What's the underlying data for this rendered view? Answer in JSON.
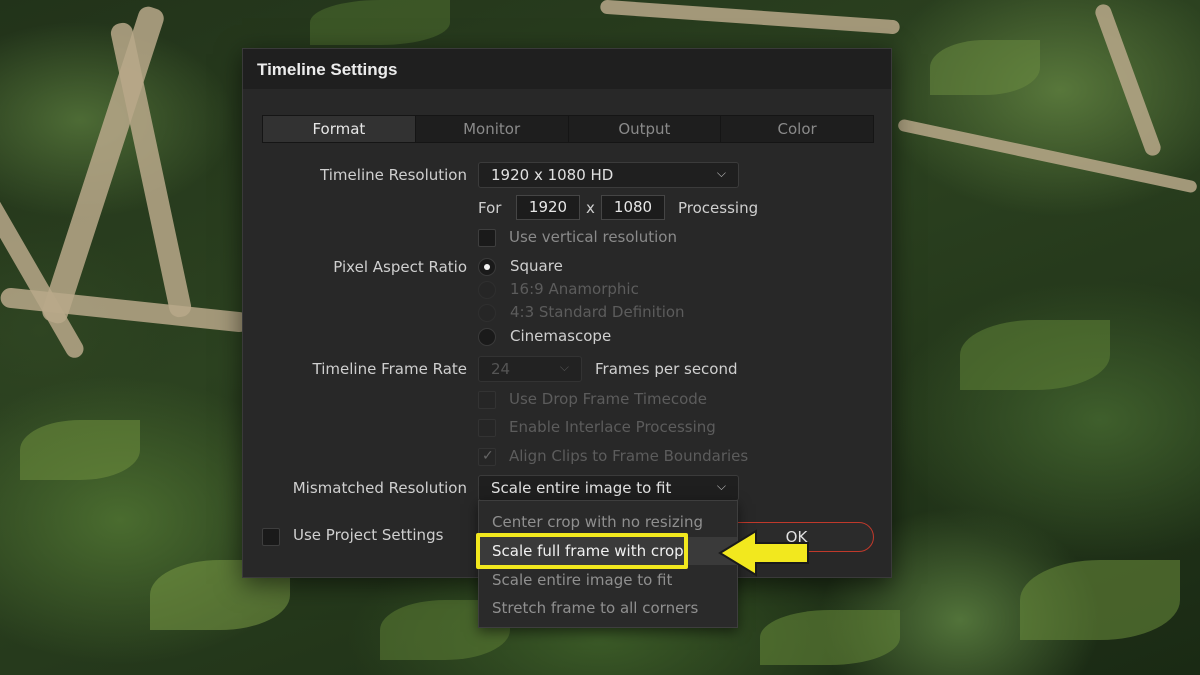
{
  "dialog": {
    "title": "Timeline Settings",
    "tabs": [
      "Format",
      "Monitor",
      "Output",
      "Color"
    ],
    "active_tab": "Format"
  },
  "format": {
    "timeline_resolution_label": "Timeline Resolution",
    "timeline_resolution_value": "1920 x 1080 HD",
    "for_label": "For",
    "width": "1920",
    "x_label": "x",
    "height": "1080",
    "processing_label": "Processing",
    "use_vertical_label": "Use vertical resolution",
    "pixel_aspect_label": "Pixel Aspect Ratio",
    "pixel_aspect_options": [
      "Square",
      "16:9 Anamorphic",
      "4:3 Standard Definition",
      "Cinemascope"
    ],
    "frame_rate_label": "Timeline Frame Rate",
    "frame_rate_value": "24",
    "fps_label": "Frames per second",
    "drop_frame_label": "Use Drop Frame Timecode",
    "interlace_label": "Enable Interlace Processing",
    "align_clips_label": "Align Clips to Frame Boundaries",
    "mismatched_label": "Mismatched Resolution",
    "mismatched_value": "Scale entire image to fit",
    "use_project_label": "Use Project Settings",
    "ok_label": "OK"
  },
  "dropdown": {
    "items": [
      "Center crop with no resizing",
      "Scale full frame with crop",
      "Scale entire image to fit",
      "Stretch frame to all corners"
    ],
    "highlighted": "Scale full frame with crop"
  },
  "colors": {
    "accent_highlight": "#f2e81e",
    "ok_border": "#c0392b"
  }
}
